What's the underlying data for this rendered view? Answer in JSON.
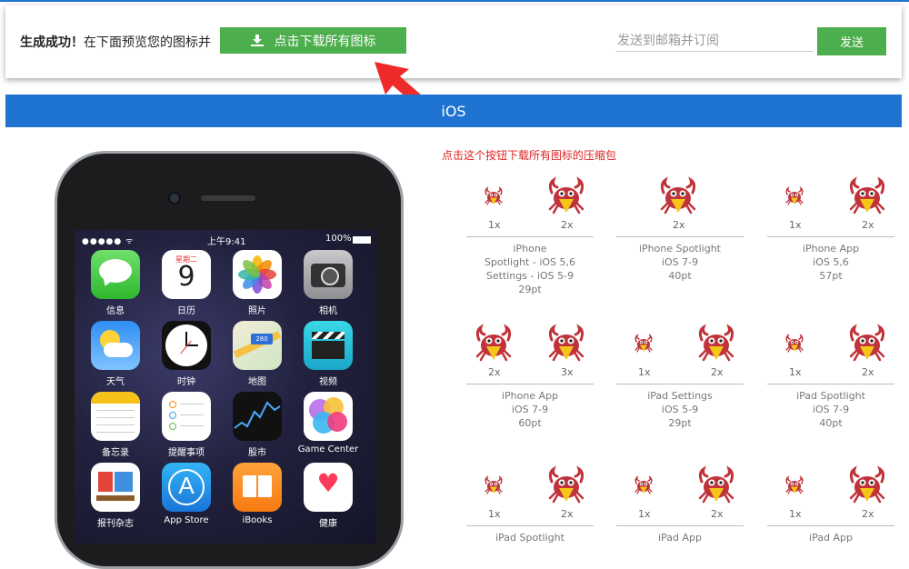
{
  "header": {
    "success_bold": "生成成功！",
    "success_text": "在下面预览您的图标并",
    "download_label": "点击下载所有图标",
    "email_placeholder": "发送到邮箱并订阅",
    "send_label": "发送"
  },
  "banner": {
    "title": "iOS"
  },
  "hint": "点击这个按钮下载所有图标的压缩包",
  "phone": {
    "status_time": "上午9:41",
    "status_battery": "100%",
    "calendar_weekday": "星期二",
    "calendar_day": "9",
    "maps_badge": "280",
    "apps": [
      "信息",
      "日历",
      "照片",
      "相机",
      "天气",
      "时钟",
      "地图",
      "视频",
      "备忘录",
      "提醒事项",
      "股市",
      "Game Center",
      "报刊杂志",
      "App Store",
      "iBooks",
      "健康"
    ]
  },
  "icon_sets": [
    {
      "scales": [
        "1x",
        "2x"
      ],
      "lines": [
        "iPhone",
        "Spotlight - iOS 5,6",
        "Settings - iOS 5-9",
        "29pt"
      ]
    },
    {
      "scales": [
        "2x"
      ],
      "lines": [
        "iPhone Spotlight",
        "iOS 7-9",
        "40pt"
      ]
    },
    {
      "scales": [
        "1x",
        "2x"
      ],
      "lines": [
        "iPhone App",
        "iOS 5,6",
        "57pt"
      ]
    },
    {
      "scales": [
        "2x",
        "3x"
      ],
      "lines": [
        "iPhone App",
        "iOS 7-9",
        "60pt"
      ]
    },
    {
      "scales": [
        "1x",
        "2x"
      ],
      "lines": [
        "iPad Settings",
        "iOS 5-9",
        "29pt"
      ]
    },
    {
      "scales": [
        "1x",
        "2x"
      ],
      "lines": [
        "iPad Spotlight",
        "iOS 7-9",
        "40pt"
      ]
    },
    {
      "scales": [
        "1x",
        "2x"
      ],
      "lines": [
        "iPad Spotlight"
      ]
    },
    {
      "scales": [
        "1x",
        "2x"
      ],
      "lines": [
        "iPad App"
      ]
    },
    {
      "scales": [
        "1x",
        "2x"
      ],
      "lines": [
        "iPad App"
      ]
    }
  ],
  "colors": {
    "accent": "#1e74d0",
    "button_green": "#4cae4c",
    "hint_red": "#e02020",
    "crab_red": "#c0333a",
    "crab_yellow": "#f5c518"
  }
}
